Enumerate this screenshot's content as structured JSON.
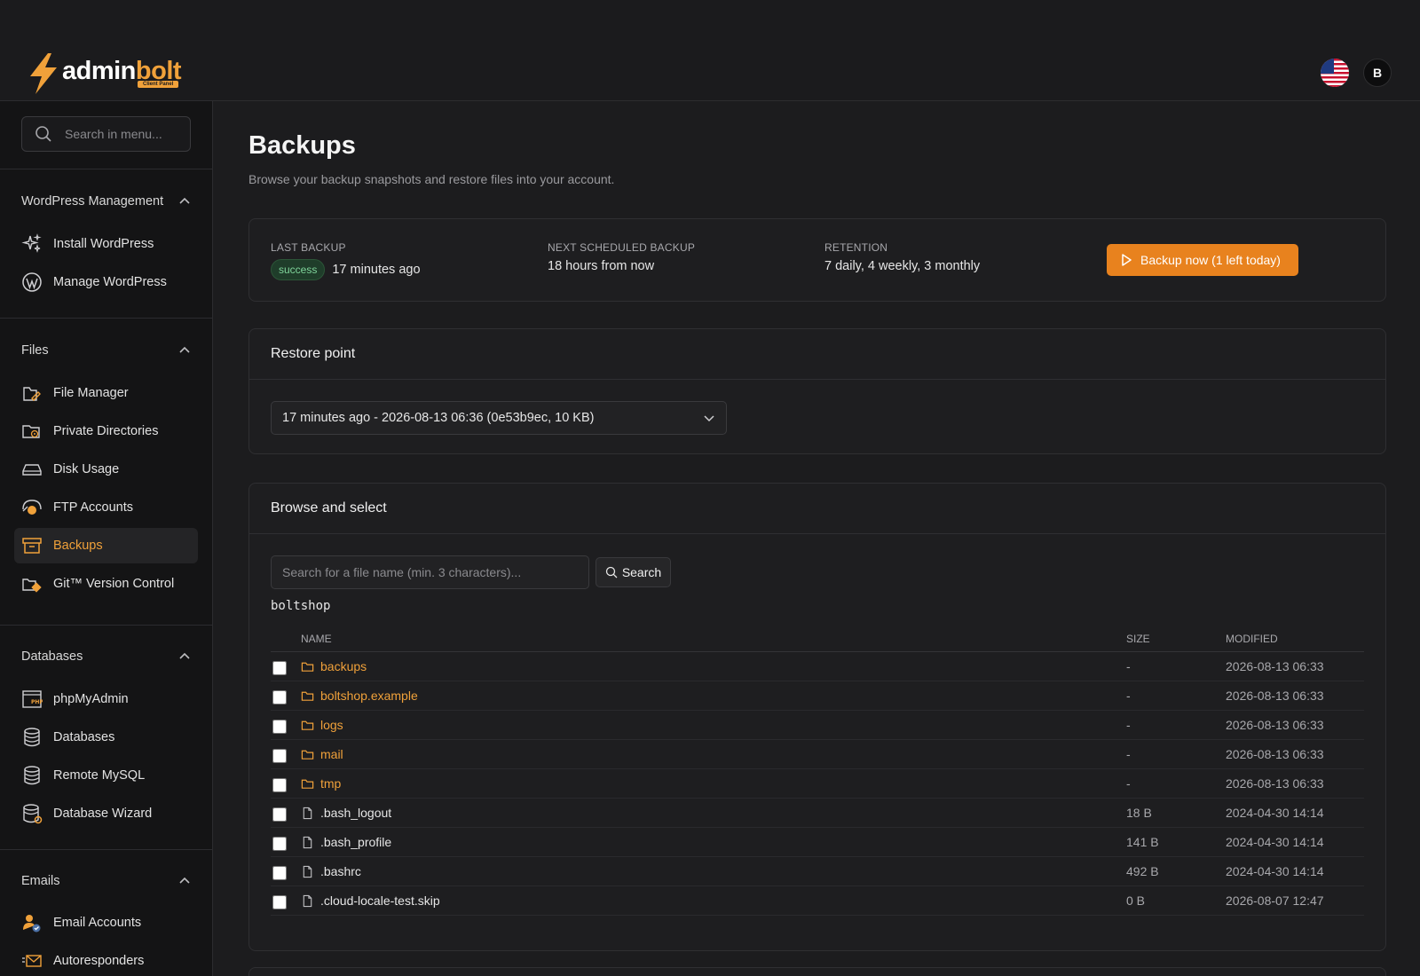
{
  "brand": {
    "name_part1": "admin",
    "name_part2": "bolt",
    "tagline": "Client Panel"
  },
  "header": {
    "avatar_initial": "B",
    "flag_icon": "us-flag-icon"
  },
  "sidebar": {
    "search_placeholder": "Search in menu...",
    "sections": [
      {
        "title": "WordPress Management",
        "items": [
          {
            "label": "Install WordPress",
            "icon": "sparkles-icon"
          },
          {
            "label": "Manage WordPress",
            "icon": "wordpress-icon"
          }
        ]
      },
      {
        "title": "Files",
        "items": [
          {
            "label": "File Manager",
            "icon": "file-manager-icon"
          },
          {
            "label": "Private Directories",
            "icon": "private-folder-icon"
          },
          {
            "label": "Disk Usage",
            "icon": "disk-icon"
          },
          {
            "label": "FTP Accounts",
            "icon": "ftp-icon"
          },
          {
            "label": "Backups",
            "icon": "archive-icon",
            "active": true
          },
          {
            "label": "Git™ Version Control",
            "icon": "git-icon"
          }
        ]
      },
      {
        "title": "Databases",
        "items": [
          {
            "label": "phpMyAdmin",
            "icon": "php-icon"
          },
          {
            "label": "Databases",
            "icon": "database-icon"
          },
          {
            "label": "Remote MySQL",
            "icon": "remote-db-icon"
          },
          {
            "label": "Database Wizard",
            "icon": "db-wizard-icon"
          }
        ]
      },
      {
        "title": "Emails",
        "items": [
          {
            "label": "Email Accounts",
            "icon": "email-account-icon"
          },
          {
            "label": "Autoresponders",
            "icon": "autoresponder-icon"
          }
        ]
      }
    ]
  },
  "page": {
    "title": "Backups",
    "subtitle": "Browse your backup snapshots and restore files into your account."
  },
  "status": {
    "last_backup_label": "LAST BACKUP",
    "last_backup_badge": "success",
    "last_backup_value": "17 minutes ago",
    "next_label": "NEXT SCHEDULED BACKUP",
    "next_value": "18 hours from now",
    "retention_label": "RETENTION",
    "retention_value": "7 daily, 4 weekly, 3 monthly",
    "backup_button": "Backup now (1 left today)",
    "accent": "#e8821e",
    "success_color": "#7fd49a"
  },
  "restore": {
    "title": "Restore point",
    "selected": "17 minutes ago - 2026-08-13 06:36 (0e53b9ec, 10 KB)"
  },
  "browse": {
    "title": "Browse and select",
    "search_placeholder": "Search for a file name (min. 3 characters)...",
    "search_button": "Search",
    "path": "boltshop",
    "columns": {
      "name": "NAME",
      "size": "SIZE",
      "modified": "MODIFIED"
    },
    "rows": [
      {
        "name": "backups",
        "type": "dir",
        "size": "-",
        "modified": "2026-08-13 06:33"
      },
      {
        "name": "boltshop.example",
        "type": "dir",
        "size": "-",
        "modified": "2026-08-13 06:33"
      },
      {
        "name": "logs",
        "type": "dir",
        "size": "-",
        "modified": "2026-08-13 06:33"
      },
      {
        "name": "mail",
        "type": "dir",
        "size": "-",
        "modified": "2026-08-13 06:33"
      },
      {
        "name": "tmp",
        "type": "dir",
        "size": "-",
        "modified": "2026-08-13 06:33"
      },
      {
        "name": ".bash_logout",
        "type": "file",
        "size": "18 B",
        "modified": "2024-04-30 14:14"
      },
      {
        "name": ".bash_profile",
        "type": "file",
        "size": "141 B",
        "modified": "2024-04-30 14:14"
      },
      {
        "name": ".bashrc",
        "type": "file",
        "size": "492 B",
        "modified": "2024-04-30 14:14"
      },
      {
        "name": ".cloud-locale-test.skip",
        "type": "file",
        "size": "0 B",
        "modified": "2026-08-07 12:47"
      }
    ]
  }
}
